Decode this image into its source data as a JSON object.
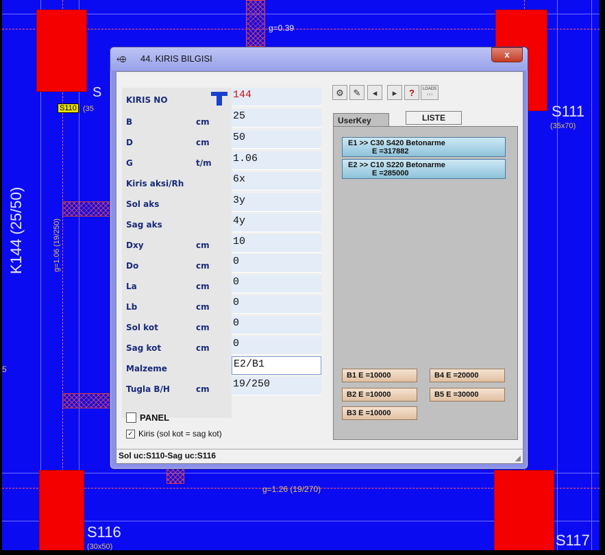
{
  "background": {
    "labels": {
      "g_top": "g=0.39",
      "s110_tag": "S110",
      "s110_dim": "(35",
      "s_partial": "S",
      "s111": "S111",
      "s111_dim": "(35x70)",
      "beam_label": "K144  (25/50)",
      "beam_g": "g=1.06  (19/250)",
      "g_bottom": "g=1.26  (19/270)",
      "s116": "S116",
      "s116_dim": "(30x50)",
      "s117": "S117",
      "left_five": "5"
    }
  },
  "dialog": {
    "title": "44. KIRIS BILGISI",
    "close": "x",
    "fields": [
      {
        "label": "KIRIS NO",
        "unit": "",
        "value": "144"
      },
      {
        "label": "B",
        "unit": "cm",
        "value": "25"
      },
      {
        "label": "D",
        "unit": "cm",
        "value": "50"
      },
      {
        "label": "G",
        "unit": "t/m",
        "value": "1.06"
      },
      {
        "label": "Kiris aksi/Rh",
        "unit": "",
        "value": "6x"
      },
      {
        "label": "Sol aks",
        "unit": "",
        "value": "3y"
      },
      {
        "label": "Sag aks",
        "unit": "",
        "value": "4y"
      },
      {
        "label": "Dxy",
        "unit": "cm",
        "value": "10"
      },
      {
        "label": "Do",
        "unit": "cm",
        "value": "0"
      },
      {
        "label": "La",
        "unit": "cm",
        "value": "0"
      },
      {
        "label": "Lb",
        "unit": "cm",
        "value": "0"
      },
      {
        "label": "Sol kot",
        "unit": "cm",
        "value": "0"
      },
      {
        "label": "Sag kot",
        "unit": "cm",
        "value": "0"
      },
      {
        "label": "Malzeme",
        "unit": "",
        "value": "E2/B1"
      },
      {
        "label": "Tugla B/H",
        "unit": "cm",
        "value": "19/250"
      }
    ],
    "panel_label": "PANEL",
    "kiris_check_label": "Kiris  (sol kot = sag kot)",
    "status": "Sol uc:S110-Sag uc:S116",
    "tabs": {
      "userkey": "UserKey",
      "liste": "LISTE"
    },
    "loads_label": "LOADS",
    "materials": [
      {
        "line1": "E1 >>  C30   S420 Betonarme",
        "line2": "E =317882"
      },
      {
        "line1": "E2 >>  C10   S220 Betonarme",
        "line2": "E =285000"
      }
    ],
    "b_buttons": [
      {
        "label": "B1  E =10000"
      },
      {
        "label": "B4  E =20000"
      },
      {
        "label": "B2  E =10000"
      },
      {
        "label": "B5  E =30000"
      },
      {
        "label": "B3  E =10000"
      }
    ]
  },
  "colors": {
    "cad_bg": "#0b0bf2",
    "column_red": "#f40000",
    "value_red": "#c01010"
  }
}
